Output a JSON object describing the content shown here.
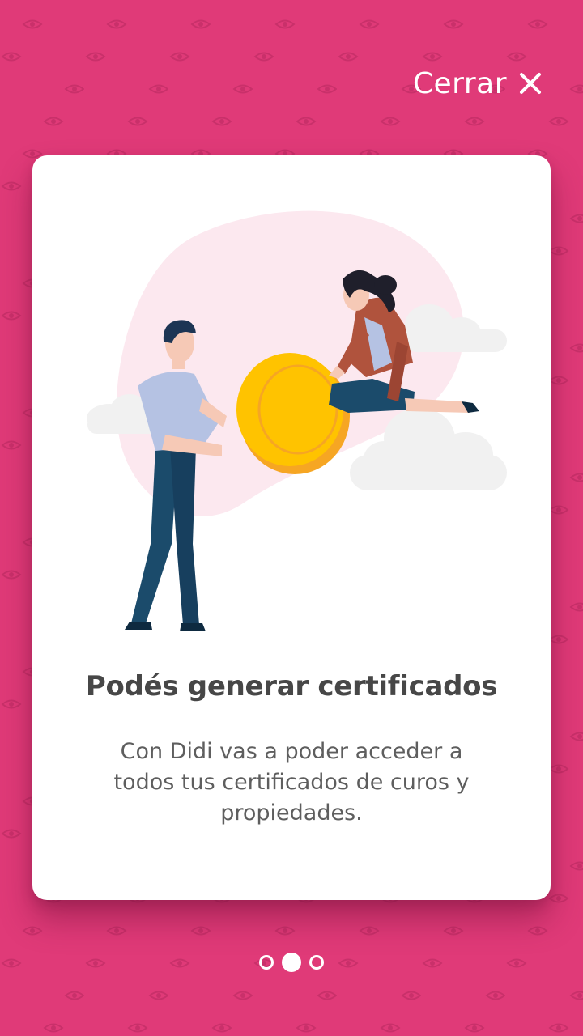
{
  "header": {
    "close_label": "Cerrar",
    "close_icon": "close-icon"
  },
  "slide": {
    "title": "Podés generar certificados",
    "body": "Con Didi vas a poder acceder a todos tus certificados de curos y propiedades.",
    "illustration": "people-exchanging-coin-illustration"
  },
  "pager": {
    "total": 3,
    "current": 2
  },
  "colors": {
    "background": "#E03A78",
    "card": "#FFFFFF",
    "coin": "#FFC300",
    "title": "#474747",
    "body": "#5E5E5E"
  }
}
